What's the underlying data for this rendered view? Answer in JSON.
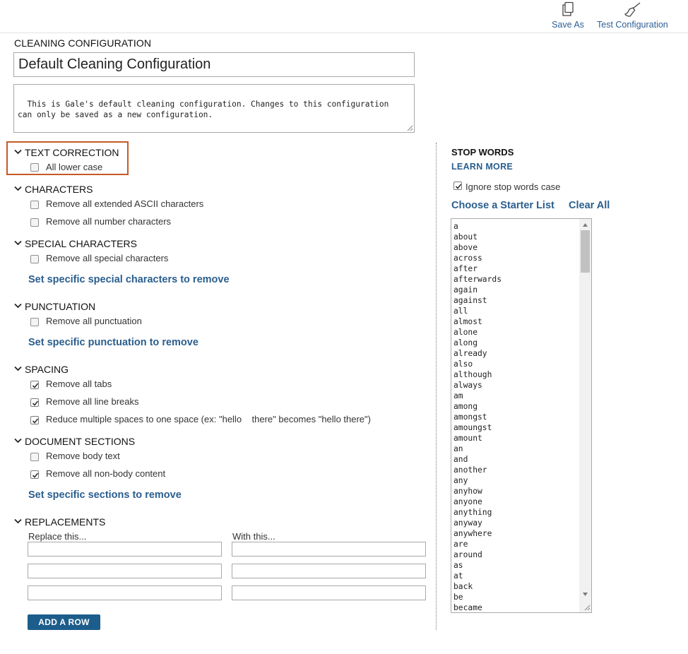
{
  "toolbar": {
    "save_as_label": "Save As",
    "test_configuration_label": "Test Configuration",
    "save_as_icon": "copy-icon",
    "test_configuration_icon": "broom-icon"
  },
  "config": {
    "heading": "CLEANING CONFIGURATION",
    "name_value": "Default Cleaning Configuration",
    "description": "This is Gale's default cleaning configuration. Changes to this configuration\ncan only be saved as a new configuration."
  },
  "sections": {
    "text_correction": {
      "title": "TEXT CORRECTION",
      "options": [
        {
          "label": "All lower case",
          "checked": false
        }
      ]
    },
    "characters": {
      "title": "CHARACTERS",
      "options": [
        {
          "label": "Remove all extended ASCII characters",
          "checked": false
        },
        {
          "label": "Remove all number characters",
          "checked": false
        }
      ]
    },
    "special_characters": {
      "title": "SPECIAL CHARACTERS",
      "options": [
        {
          "label": "Remove all special characters",
          "checked": false
        }
      ],
      "link": "Set specific special characters to remove"
    },
    "punctuation": {
      "title": "PUNCTUATION",
      "options": [
        {
          "label": "Remove all punctuation",
          "checked": false
        }
      ],
      "link": "Set specific punctuation to remove"
    },
    "spacing": {
      "title": "SPACING",
      "options": [
        {
          "label": "Remove all tabs",
          "checked": true
        },
        {
          "label": "Remove all line breaks",
          "checked": true
        },
        {
          "label": "Reduce multiple spaces to one space (ex: \"hello    there\" becomes \"hello there\")",
          "checked": true
        }
      ]
    },
    "document_sections": {
      "title": "DOCUMENT SECTIONS",
      "options": [
        {
          "label": "Remove body text",
          "checked": false
        },
        {
          "label": "Remove all non-body content",
          "checked": true
        }
      ],
      "link": "Set specific sections to remove"
    },
    "replacements": {
      "title": "REPLACEMENTS",
      "replace_header": "Replace this...",
      "with_header": "With this...",
      "rows": [
        {
          "replace": "",
          "with": ""
        },
        {
          "replace": "",
          "with": ""
        },
        {
          "replace": "",
          "with": ""
        }
      ],
      "add_row_label": "ADD A ROW"
    }
  },
  "stop_words": {
    "title": "STOP WORDS",
    "learn_more": "LEARN MORE",
    "ignore_case_label": "Ignore stop words case",
    "ignore_case_checked": true,
    "choose_starter_list": "Choose a Starter List",
    "clear_all": "Clear All",
    "words": [
      "a",
      "about",
      "above",
      "across",
      "after",
      "afterwards",
      "again",
      "against",
      "all",
      "almost",
      "alone",
      "along",
      "already",
      "also",
      "although",
      "always",
      "am",
      "among",
      "amongst",
      "amoungst",
      "amount",
      "an",
      "and",
      "another",
      "any",
      "anyhow",
      "anyone",
      "anything",
      "anyway",
      "anywhere",
      "are",
      "around",
      "as",
      "at",
      "back",
      "be",
      "became"
    ]
  },
  "colors": {
    "link": "#2a5e8e",
    "button": "#1d5d8b",
    "highlight_border": "#c65a25"
  }
}
